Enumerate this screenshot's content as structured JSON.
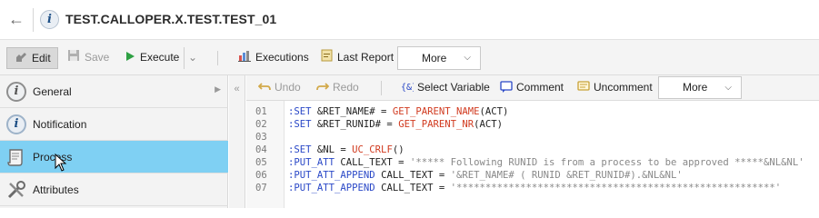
{
  "window": {
    "title": "TEST.CALLOPER.X.TEST.TEST_01"
  },
  "toolbar": {
    "edit_label": "Edit",
    "save_label": "Save",
    "execute_label": "Execute",
    "executions_label": "Executions",
    "last_report_label": "Last Report",
    "more_label": "More"
  },
  "sidebar": {
    "items": [
      {
        "label": "General",
        "icon": "info-circle-icon",
        "active": false
      },
      {
        "label": "Notification",
        "icon": "info-blue-icon",
        "active": false
      },
      {
        "label": "Process",
        "icon": "scroll-icon",
        "active": true
      },
      {
        "label": "Attributes",
        "icon": "tools-icon",
        "active": false
      }
    ]
  },
  "editor_toolbar": {
    "undo_label": "Undo",
    "redo_label": "Redo",
    "select_variable_label": "Select Variable",
    "comment_label": "Comment",
    "uncomment_label": "Uncomment",
    "more_label": "More"
  },
  "code": {
    "lines": [
      {
        "num": "01",
        "parts": [
          [
            ":SET ",
            "kw"
          ],
          [
            "&RET_NAME# = ",
            "var"
          ],
          [
            "GET_PARENT_NAME",
            "fn"
          ],
          [
            "(ACT)",
            "op"
          ]
        ]
      },
      {
        "num": "02",
        "parts": [
          [
            ":SET ",
            "kw"
          ],
          [
            "&RET_RUNID# = ",
            "var"
          ],
          [
            "GET_PARENT_NR",
            "fn"
          ],
          [
            "(ACT)",
            "op"
          ]
        ]
      },
      {
        "num": "03",
        "parts": []
      },
      {
        "num": "04",
        "parts": [
          [
            ":SET ",
            "kw"
          ],
          [
            "&NL = ",
            "var"
          ],
          [
            "UC_CRLF",
            "fn"
          ],
          [
            "()",
            "op"
          ]
        ]
      },
      {
        "num": "05",
        "parts": [
          [
            ":PUT_ATT ",
            "kw"
          ],
          [
            "CALL_TEXT = ",
            "var"
          ],
          [
            "'***** Following RUNID is from a process to be approved *****&NL&NL'",
            "str"
          ]
        ]
      },
      {
        "num": "06",
        "parts": [
          [
            ":PUT_ATT_APPEND ",
            "kw"
          ],
          [
            "CALL_TEXT = ",
            "var"
          ],
          [
            "'&RET_NAME# ( RUNID &RET_RUNID#).&NL&NL'",
            "str"
          ]
        ]
      },
      {
        "num": "07",
        "parts": [
          [
            ":PUT_ATT_APPEND ",
            "kw"
          ],
          [
            "CALL_TEXT = ",
            "var"
          ],
          [
            "'*******************************************************'",
            "str"
          ]
        ]
      }
    ]
  },
  "colors": {
    "active_item": "#7fd0f3",
    "keyword": "#2a48c7",
    "function": "#d13a1f",
    "string": "#888888"
  }
}
